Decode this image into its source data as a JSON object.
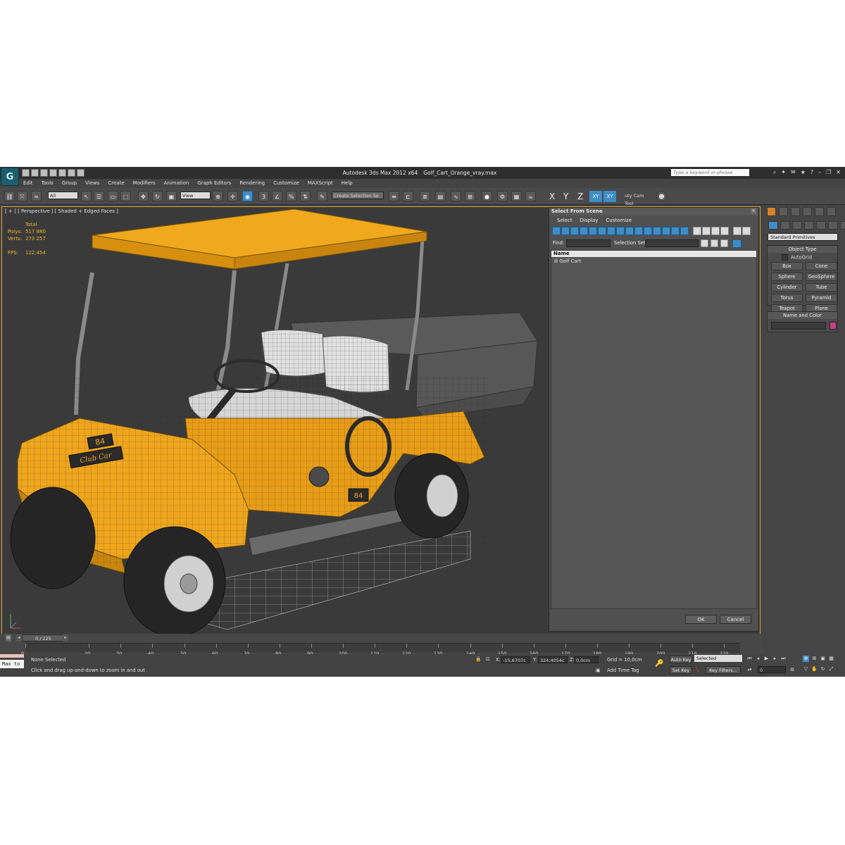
{
  "window": {
    "app_name": "Autodesk 3ds Max  2012 x64",
    "file_name": "Golf_Cart_Orange_vray.max",
    "search_placeholder": "Type a keyword or phrase"
  },
  "menu": [
    "Edit",
    "Tools",
    "Group",
    "Views",
    "Create",
    "Modifiers",
    "Animation",
    "Graph Editors",
    "Rendering",
    "Customize",
    "MAXScript",
    "Help"
  ],
  "toolbar": {
    "filter_value": "All",
    "ref_coord_value": "View",
    "percent_snap_label": "3",
    "selection_set_placeholder": "Create Selection Se",
    "axes": [
      "X",
      "Y",
      "Z",
      "XY",
      "XY"
    ],
    "tool_dropdown": "uty Cam Tool"
  },
  "viewport": {
    "label": "[ + ] [ Perspective ] [ Shaded + Edged Faces ]",
    "stats_header": "Total",
    "polys_label": "Polys:",
    "polys_value": "517 880",
    "verts_label": "Verts:",
    "verts_value": "273 257",
    "fps_label": "FPS:",
    "fps_value": "122,454",
    "cart_badge": "84",
    "cart_brand": "Club Car",
    "cart_side_badge": "84"
  },
  "dialog": {
    "title": "Select From Scene",
    "menu": [
      "Select",
      "Display",
      "Customize"
    ],
    "find_label": "Find:",
    "selection_set_label": "Selection Set:",
    "column_header": "Name",
    "items": [
      "Golf Cart"
    ],
    "ok_label": "OK",
    "cancel_label": "Cancel"
  },
  "command_panel": {
    "category": "Standard Primitives",
    "object_type_header": "Object Type",
    "autogrid_label": "AutoGrid",
    "primitives": [
      "Box",
      "Cone",
      "Sphere",
      "GeoSphere",
      "Cylinder",
      "Tube",
      "Torus",
      "Pyramid",
      "Teapot",
      "Plane"
    ],
    "name_color_header": "Name and Color",
    "object_color": "#c63d8e"
  },
  "timeline": {
    "frame_display": "0 / 225",
    "ticks": [
      "0",
      "20",
      "30",
      "40",
      "50",
      "60",
      "70",
      "80",
      "90",
      "100",
      "110",
      "120",
      "130",
      "140",
      "150",
      "160",
      "170",
      "180",
      "190",
      "200",
      "210",
      "220"
    ]
  },
  "status": {
    "maxscript_label": "Max to",
    "selection_text": "None Selected",
    "prompt_text": "Click and drag up-and-down to zoom in and out",
    "x_label": "X:",
    "x_value": "-15,6707c",
    "y_label": "Y:",
    "y_value": "324,4054c",
    "z_label": "Z:",
    "z_value": "0,0cm",
    "grid_text": "Grid = 10,0cm",
    "add_time_tag": "Add Time Tag",
    "auto_key": "Auto Key",
    "selected_value": "Selected",
    "set_key": "Set Key",
    "key_filters": "Key Filters...",
    "frame_field": "0"
  },
  "colors": {
    "accent_blue": "#3f8dc7",
    "viewport_border": "#d9a43a",
    "stats_text": "#f3b92f",
    "cart_orange": "#f0a81c"
  }
}
